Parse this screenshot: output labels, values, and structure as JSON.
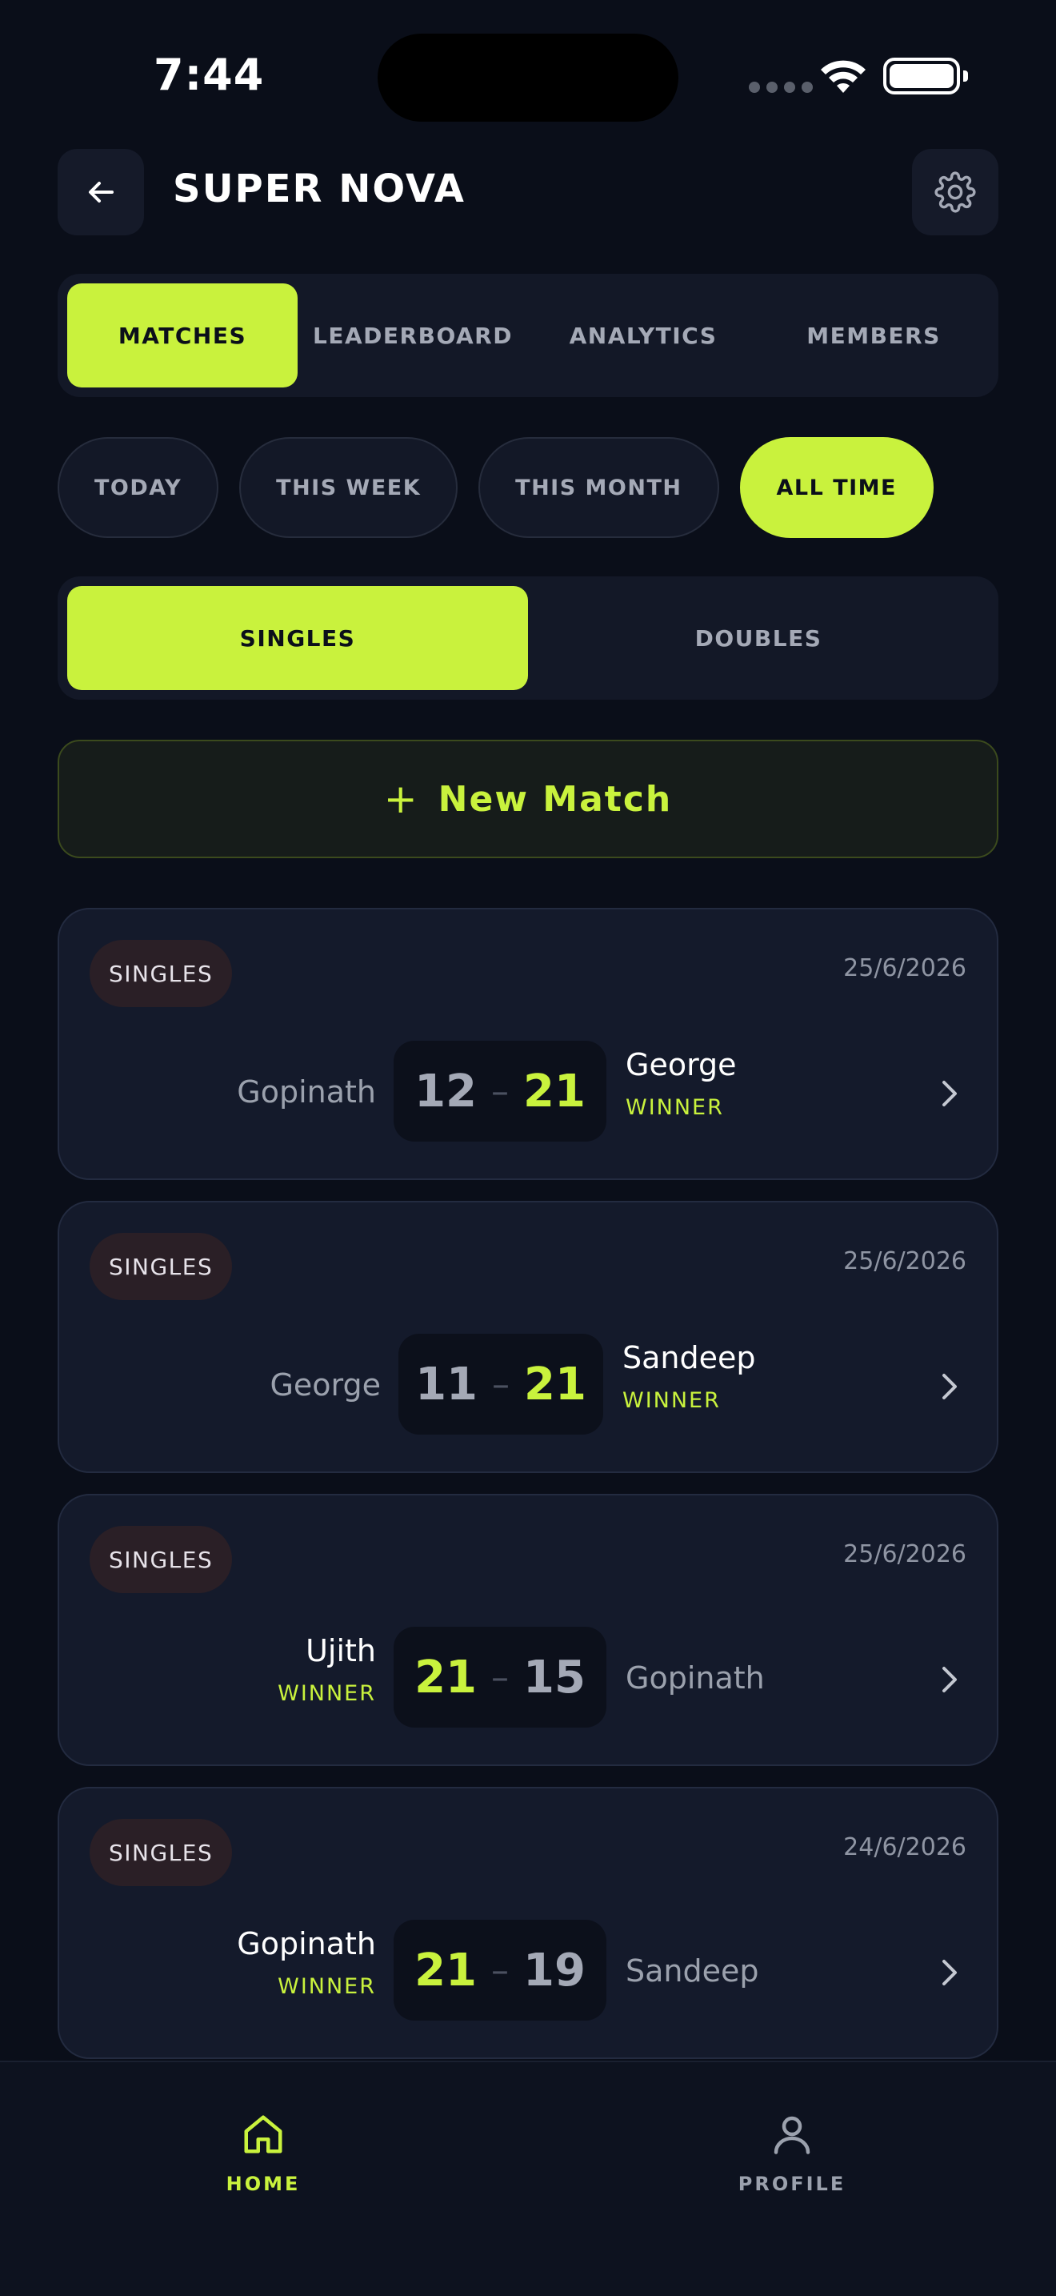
{
  "status": {
    "time": "7:44"
  },
  "header": {
    "title": "SUPER NOVA"
  },
  "main_tabs": [
    {
      "label": "MATCHES",
      "active": true
    },
    {
      "label": "LEADERBOARD",
      "active": false
    },
    {
      "label": "ANALYTICS",
      "active": false
    },
    {
      "label": "MEMBERS",
      "active": false
    }
  ],
  "period_chips": [
    {
      "label": "TODAY",
      "active": false
    },
    {
      "label": "THIS WEEK",
      "active": false
    },
    {
      "label": "THIS MONTH",
      "active": false
    },
    {
      "label": "ALL TIME",
      "active": true
    }
  ],
  "type_toggle": [
    {
      "label": "SINGLES",
      "active": true
    },
    {
      "label": "DOUBLES",
      "active": false
    }
  ],
  "new_match": {
    "plus": "+",
    "label": "New Match"
  },
  "matches": [
    {
      "badge": "SINGLES",
      "date": "25/6/2026",
      "left": {
        "name": "Gopinath",
        "score": "12",
        "winner": false
      },
      "right": {
        "name": "George",
        "score": "21",
        "winner": true
      },
      "winner_label": "WINNER"
    },
    {
      "badge": "SINGLES",
      "date": "25/6/2026",
      "left": {
        "name": "George",
        "score": "11",
        "winner": false
      },
      "right": {
        "name": "Sandeep",
        "score": "21",
        "winner": true
      },
      "winner_label": "WINNER"
    },
    {
      "badge": "SINGLES",
      "date": "25/6/2026",
      "left": {
        "name": "Ujith",
        "score": "21",
        "winner": true
      },
      "right": {
        "name": "Gopinath",
        "score": "15",
        "winner": false
      },
      "winner_label": "WINNER"
    },
    {
      "badge": "SINGLES",
      "date": "24/6/2026",
      "left": {
        "name": "Gopinath",
        "score": "21",
        "winner": true
      },
      "right": {
        "name": "Sandeep",
        "score": "19",
        "winner": false
      },
      "winner_label": "WINNER"
    }
  ],
  "bottom_nav": {
    "home": {
      "label": "HOME",
      "icon": "home-icon",
      "active": true
    },
    "profile": {
      "label": "PROFILE",
      "icon": "user-icon",
      "active": false
    }
  },
  "colors": {
    "accent": "#c9f23d",
    "background": "#0a0e19",
    "card": "#141a2b"
  }
}
